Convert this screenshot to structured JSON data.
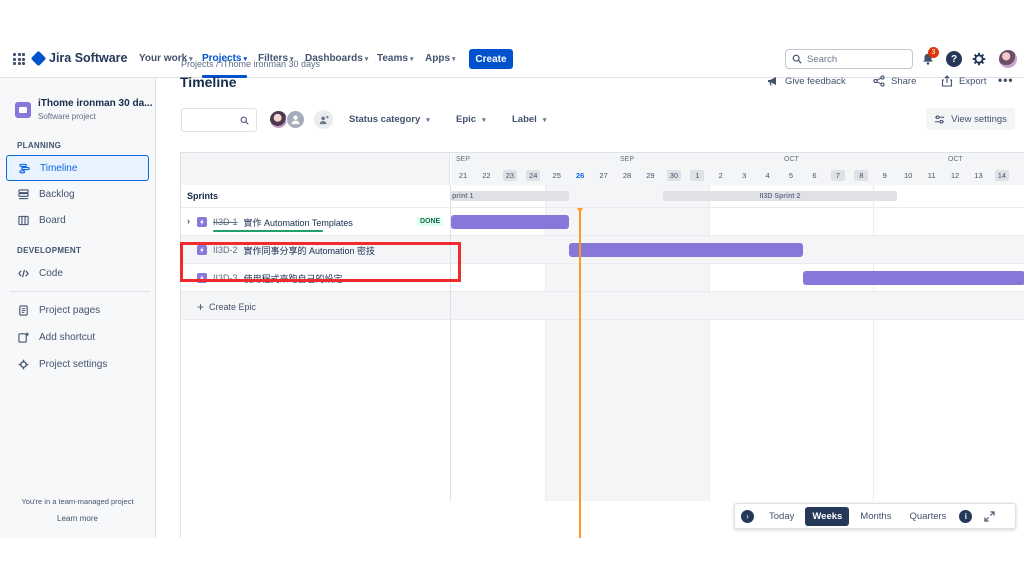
{
  "nav": {
    "product": "Jira Software",
    "items": [
      {
        "label": "Your work"
      },
      {
        "label": "Projects"
      },
      {
        "label": "Filters"
      },
      {
        "label": "Dashboards"
      },
      {
        "label": "Teams"
      },
      {
        "label": "Apps"
      }
    ],
    "create_label": "Create",
    "search_placeholder": "Search",
    "notification_count": "3"
  },
  "sidebar": {
    "project_name": "iThome ironman 30 da...",
    "project_type": "Software project",
    "planning_label": "PLANNING",
    "development_label": "DEVELOPMENT",
    "items": {
      "timeline": "Timeline",
      "backlog": "Backlog",
      "board": "Board",
      "code": "Code",
      "project_pages": "Project pages",
      "add_shortcut": "Add shortcut",
      "project_settings": "Project settings"
    },
    "team_note": "You're in a team-managed project",
    "learn_more": "Learn more"
  },
  "header": {
    "breadcrumb": "Projects  /  iThome ironman 30 days",
    "title": "Timeline",
    "give_feedback": "Give feedback",
    "share": "Share",
    "export": "Export",
    "more": "•••"
  },
  "filters": {
    "status_category": "Status category",
    "epic": "Epic",
    "label": "Label",
    "view_settings": "View settings"
  },
  "timeline": {
    "months": [
      "SEP",
      "SEP",
      "OCT",
      "OCT"
    ],
    "days": [
      "21",
      "22",
      "23",
      "24",
      "25",
      "26",
      "27",
      "28",
      "29",
      "30",
      "1",
      "2",
      "3",
      "4",
      "5",
      "6",
      "7",
      "8",
      "9",
      "10",
      "11",
      "12",
      "13",
      "14"
    ],
    "weekend_days": [
      "23",
      "24",
      "30",
      "1",
      "7",
      "8",
      "14"
    ],
    "today": "26",
    "sprints_label": "Sprints",
    "sprints": [
      {
        "name": "print 1"
      },
      {
        "name": "II3D Sprint 2"
      }
    ],
    "epics": [
      {
        "key": "II3D-1",
        "title": "實作 Automation Templates",
        "status": "DONE",
        "done": true
      },
      {
        "key": "II3D-2",
        "title": "實作同事分享的 Automation 密技",
        "status": "",
        "done": false
      },
      {
        "key": "II3D-3",
        "title": "使用程式來跑自己的設定",
        "status": "",
        "done": false
      }
    ],
    "create_epic": "Create Epic"
  },
  "zoom": {
    "today": "Today",
    "weeks": "Weeks",
    "months": "Months",
    "quarters": "Quarters",
    "info": "i"
  },
  "colors": {
    "accent": "#0052CC",
    "epic_bar": "#8777D9",
    "today_marker": "#FF991F",
    "highlight": "#EF2B2D"
  }
}
